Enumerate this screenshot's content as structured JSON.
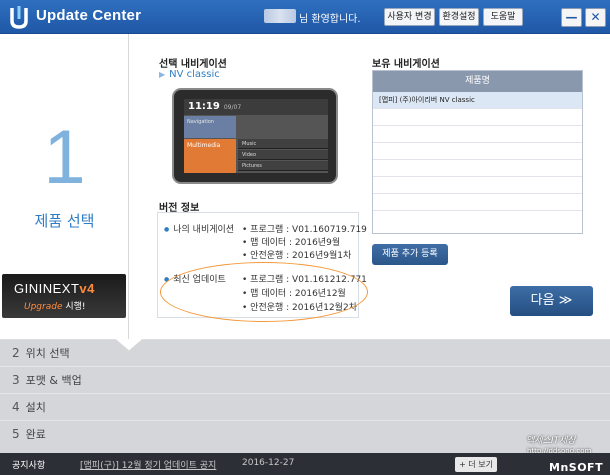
{
  "titlebar": {
    "app_title": "Update Center",
    "welcome": "님 환영합니다.",
    "buttons": [
      "사용자 변경",
      "환경설정",
      "도움말"
    ],
    "minimize": "—",
    "close": "✕"
  },
  "step_panel": {
    "number": "1",
    "label": "제품 선택",
    "promo_title_a": "GININEXT",
    "promo_title_b": "v4",
    "promo_sub_a": "Upgrade",
    "promo_sub_b": " 시행!"
  },
  "selected_nav": {
    "heading": "선택 내비게이션",
    "name": "NV classic"
  },
  "device_screen": {
    "time": "11:19",
    "date": "09/07",
    "tile_top": "Navigation",
    "tile_bottom": "Multimedia",
    "rows": [
      "Music",
      "Video",
      "Pictures"
    ]
  },
  "version": {
    "heading": "버전 정보",
    "mine_label": "나의 내비게이션",
    "mine_lines": [
      "프로그램 : V01.160719.719",
      "맵 데이터 : 2016년9월",
      "안전운행 : 2016년9월1차"
    ],
    "latest_label": "최신 업데이트",
    "latest_lines": [
      "프로그램 : V01.161212.771",
      "맵 데이터 : 2016년12월",
      "안전운행 : 2016년12월2차"
    ]
  },
  "owned_nav": {
    "heading": "보유 내비게이션",
    "column": "제품명",
    "rows": [
      "[맵피] (주)아이리버 NV classic"
    ]
  },
  "buttons": {
    "add_product": "제품 추가 등록",
    "next": "다음 ≫"
  },
  "steps": [
    {
      "num": "2",
      "label": "위치 선택"
    },
    {
      "num": "3",
      "label": "포맷 & 백업"
    },
    {
      "num": "4",
      "label": "설치"
    },
    {
      "num": "5",
      "label": "완료"
    }
  ],
  "notice": {
    "label": "공지사항",
    "text": "[맵피(구)] 12월 정기 업데이트 공지",
    "date": "2016-12-27",
    "more": "+ 더 보기"
  },
  "watermark": {
    "line1": "액세스IT세상",
    "line2": "http://ddsong.com",
    "brand": "MnSOFT"
  },
  "colors": {
    "titlebar": "#1f58a6",
    "accent": "#2f7dc4",
    "step_number": "#7fb2dd",
    "highlight_ellipse": "#f29a3c"
  }
}
